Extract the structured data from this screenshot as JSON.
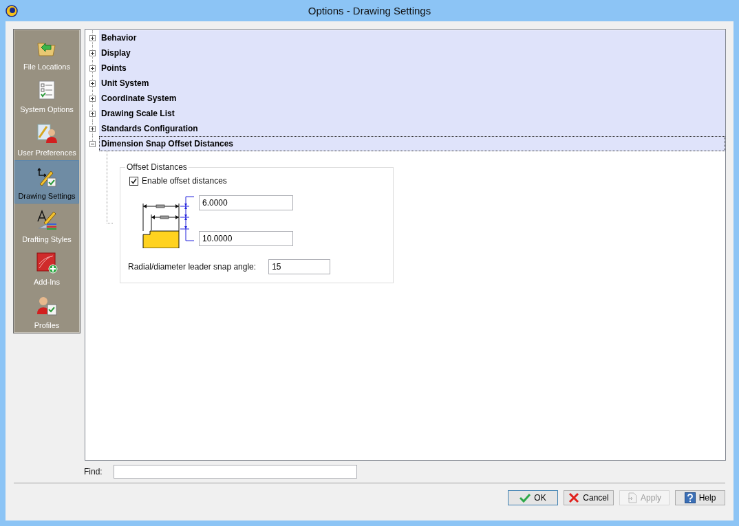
{
  "window": {
    "title": "Options - Drawing Settings"
  },
  "sidebar": {
    "items": [
      {
        "label": "File Locations",
        "kind": "folder",
        "selected": false
      },
      {
        "label": "System Options",
        "kind": "list",
        "selected": false
      },
      {
        "label": "User Preferences",
        "kind": "user",
        "selected": false
      },
      {
        "label": "Drawing Settings",
        "kind": "drawing",
        "selected": true
      },
      {
        "label": "Drafting Styles",
        "kind": "styles",
        "selected": false
      },
      {
        "label": "Add-Ins",
        "kind": "addin",
        "selected": false
      },
      {
        "label": "Profiles",
        "kind": "profile",
        "selected": false
      }
    ]
  },
  "tree": {
    "items": [
      {
        "label": "Behavior",
        "expanded": false,
        "selected": false
      },
      {
        "label": "Display",
        "expanded": false,
        "selected": false
      },
      {
        "label": "Points",
        "expanded": false,
        "selected": false
      },
      {
        "label": "Unit System",
        "expanded": false,
        "selected": false
      },
      {
        "label": "Coordinate System",
        "expanded": false,
        "selected": false
      },
      {
        "label": "Drawing Scale List",
        "expanded": false,
        "selected": false
      },
      {
        "label": "Standards Configuration",
        "expanded": false,
        "selected": false
      },
      {
        "label": "Dimension Snap Offset Distances",
        "expanded": true,
        "selected": true
      }
    ]
  },
  "group": {
    "title": "Offset Distances",
    "enable": {
      "label": "Enable offset distances",
      "checked": true
    },
    "offset_1": "6.0000",
    "offset_2": "10.0000",
    "snap_angle": {
      "label": "Radial/diameter leader snap angle:",
      "value": "15"
    }
  },
  "find": {
    "label": "Find:"
  },
  "buttons": [
    {
      "label": "OK",
      "kind": "ok",
      "disabled": false,
      "default": true
    },
    {
      "label": "Cancel",
      "kind": "cancel",
      "disabled": false,
      "default": false
    },
    {
      "label": "Apply",
      "kind": "apply",
      "disabled": true,
      "default": false
    },
    {
      "label": "Help",
      "kind": "help",
      "disabled": false,
      "default": false
    }
  ]
}
